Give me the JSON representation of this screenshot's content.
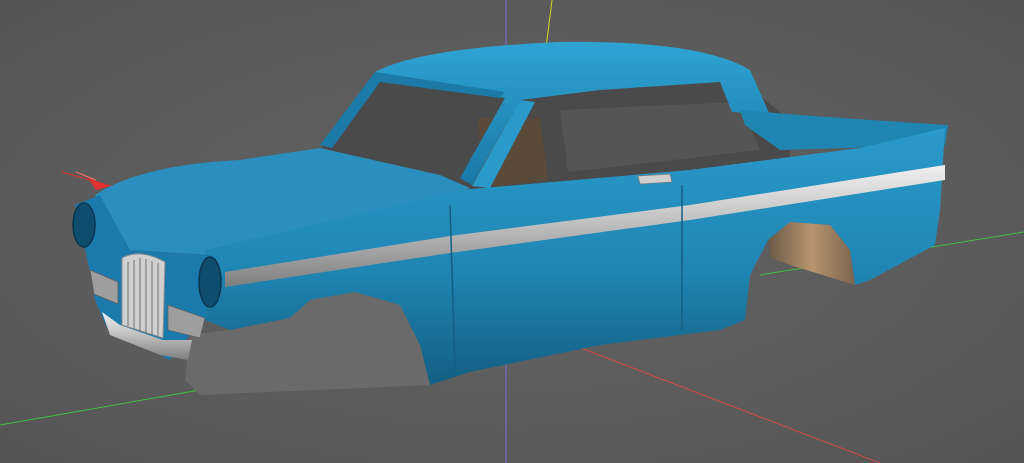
{
  "viewport": {
    "background_color": "#5c5c5c"
  },
  "axes": {
    "x_color": "#d04a4a",
    "y_color": "#d8d820",
    "z_color": "#7a6ad8",
    "ground_color": "#3fbf3f"
  },
  "model": {
    "body_color": "#1f86b4",
    "body_highlight": "#2a9acb",
    "body_shadow": "#145e82",
    "trim_color": "#c9c9c9",
    "interior_color": "#4a4a4a",
    "seat_color": "#5a4a3a"
  },
  "gizmo": {
    "icon": "axis-gizmo-icon",
    "color": "#e03030"
  }
}
